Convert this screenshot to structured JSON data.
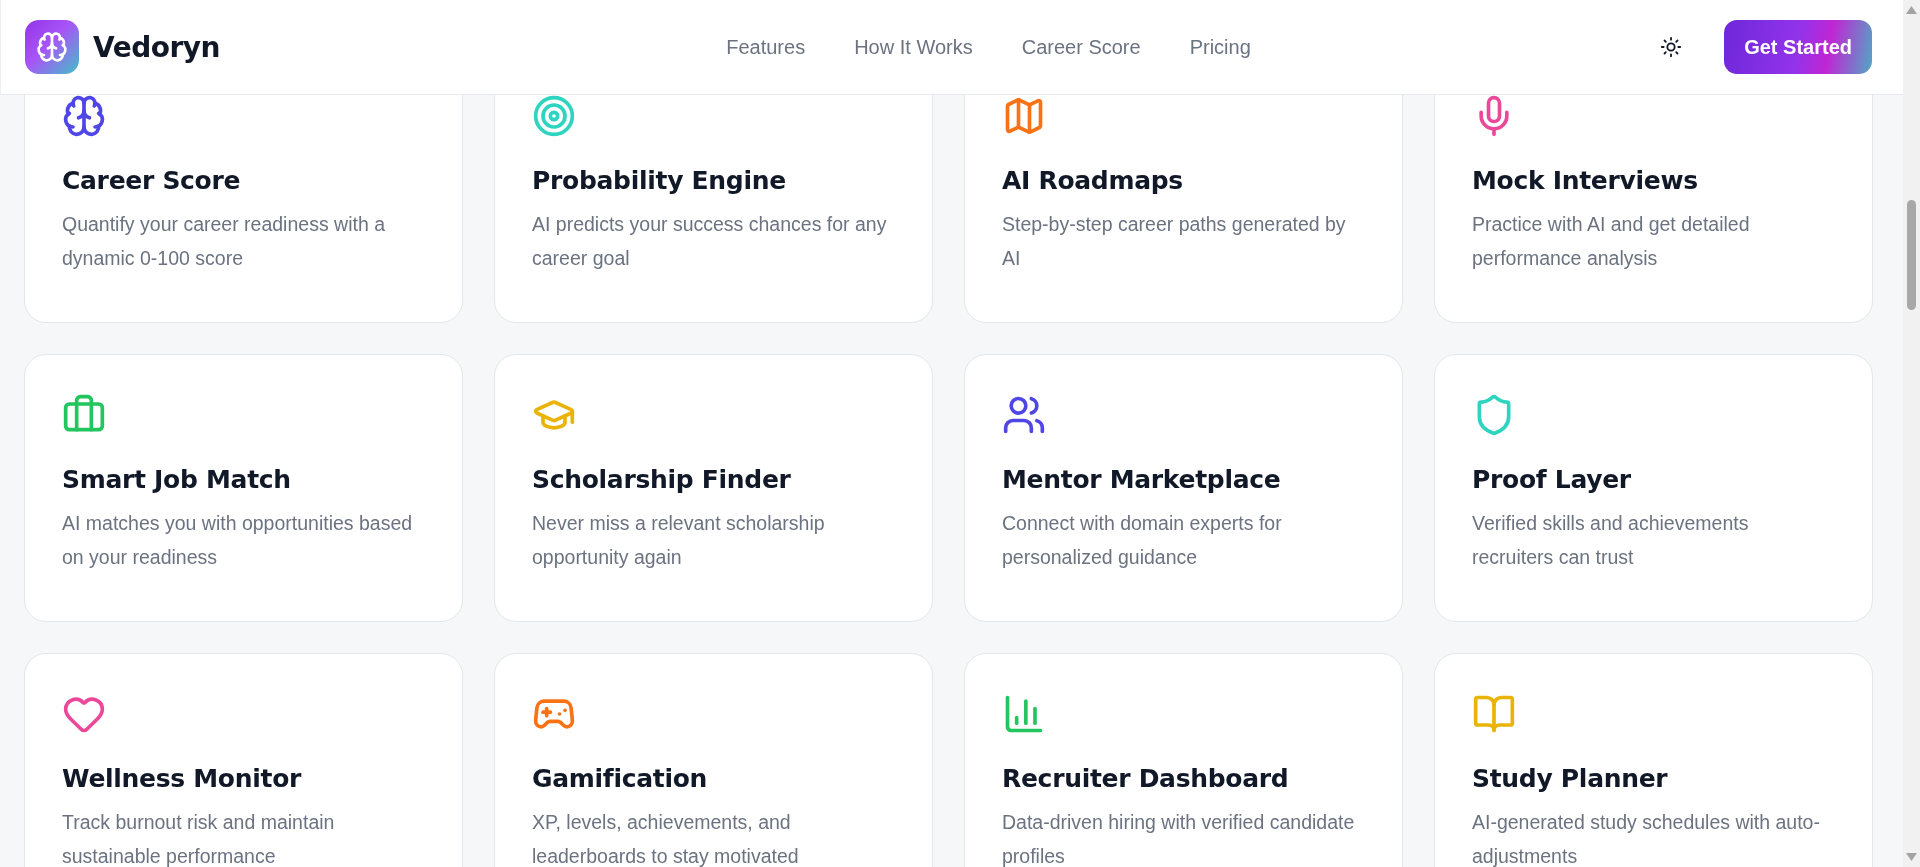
{
  "header": {
    "brand": "Vedoryn",
    "nav": [
      "Features",
      "How It Works",
      "Career Score",
      "Pricing"
    ],
    "cta": "Get Started"
  },
  "features": [
    {
      "title": "Career Score",
      "description": "Quantify your career readiness with a dynamic 0-100 score",
      "color": "#4f46e5"
    },
    {
      "title": "Probability Engine",
      "description": "AI predicts your success chances for any career goal",
      "color": "#2dd4bf"
    },
    {
      "title": "AI Roadmaps",
      "description": "Step-by-step career paths generated by AI",
      "color": "#f97316"
    },
    {
      "title": "Mock Interviews",
      "description": "Practice with AI and get detailed performance analysis",
      "color": "#ec4899"
    },
    {
      "title": "Smart Job Match",
      "description": "AI matches you with opportunities based on your readiness",
      "color": "#22c55e"
    },
    {
      "title": "Scholarship Finder",
      "description": "Never miss a relevant scholarship opportunity again",
      "color": "#eab308"
    },
    {
      "title": "Mentor Marketplace",
      "description": "Connect with domain experts for personalized guidance",
      "color": "#4f46e5"
    },
    {
      "title": "Proof Layer",
      "description": "Verified skills and achievements recruiters can trust",
      "color": "#2dd4bf"
    },
    {
      "title": "Wellness Monitor",
      "description": "Track burnout risk and maintain sustainable performance",
      "color": "#ec4899"
    },
    {
      "title": "Gamification",
      "description": "XP, levels, achievements, and leaderboards to stay motivated",
      "color": "#f97316"
    },
    {
      "title": "Recruiter Dashboard",
      "description": "Data-driven hiring with verified candidate profiles",
      "color": "#22c55e"
    },
    {
      "title": "Study Planner",
      "description": "AI-generated study schedules with auto-adjustments",
      "color": "#eab308"
    }
  ]
}
